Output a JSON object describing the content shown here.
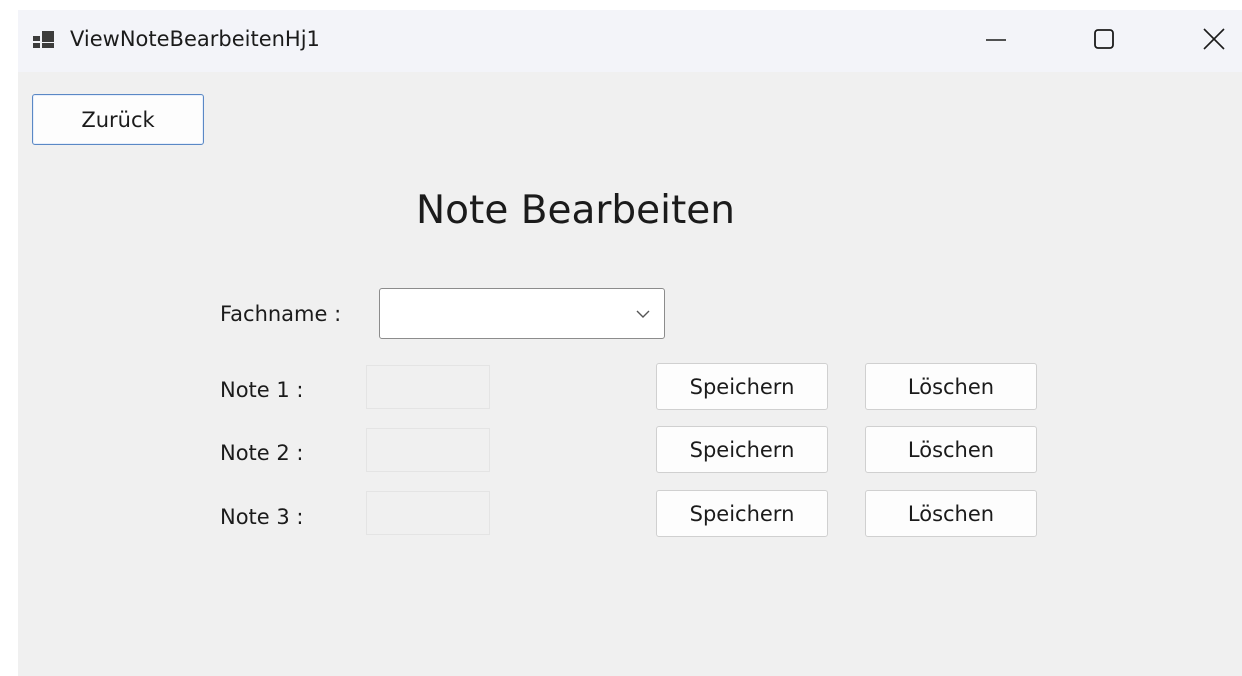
{
  "window": {
    "title": "ViewNoteBearbeitenHj1",
    "controls": {
      "minimize_icon": "minimize-icon",
      "maximize_icon": "maximize-icon",
      "close_icon": "close-icon"
    }
  },
  "toolbar": {
    "back_label": "Zurück"
  },
  "form": {
    "heading": "Note Bearbeiten",
    "subject": {
      "label": "Fachname :",
      "value": ""
    },
    "grades": [
      {
        "label": "Note 1 :",
        "value": "",
        "save_label": "Speichern",
        "delete_label": "Löschen"
      },
      {
        "label": "Note 2 :",
        "value": "",
        "save_label": "Speichern",
        "delete_label": "Löschen"
      },
      {
        "label": "Note 3 :",
        "value": "",
        "save_label": "Speichern",
        "delete_label": "Löschen"
      }
    ]
  },
  "colors": {
    "window_background": "#f0f0f0",
    "titlebar_background": "#f3f4f9",
    "focus_border": "#5a88c5"
  }
}
